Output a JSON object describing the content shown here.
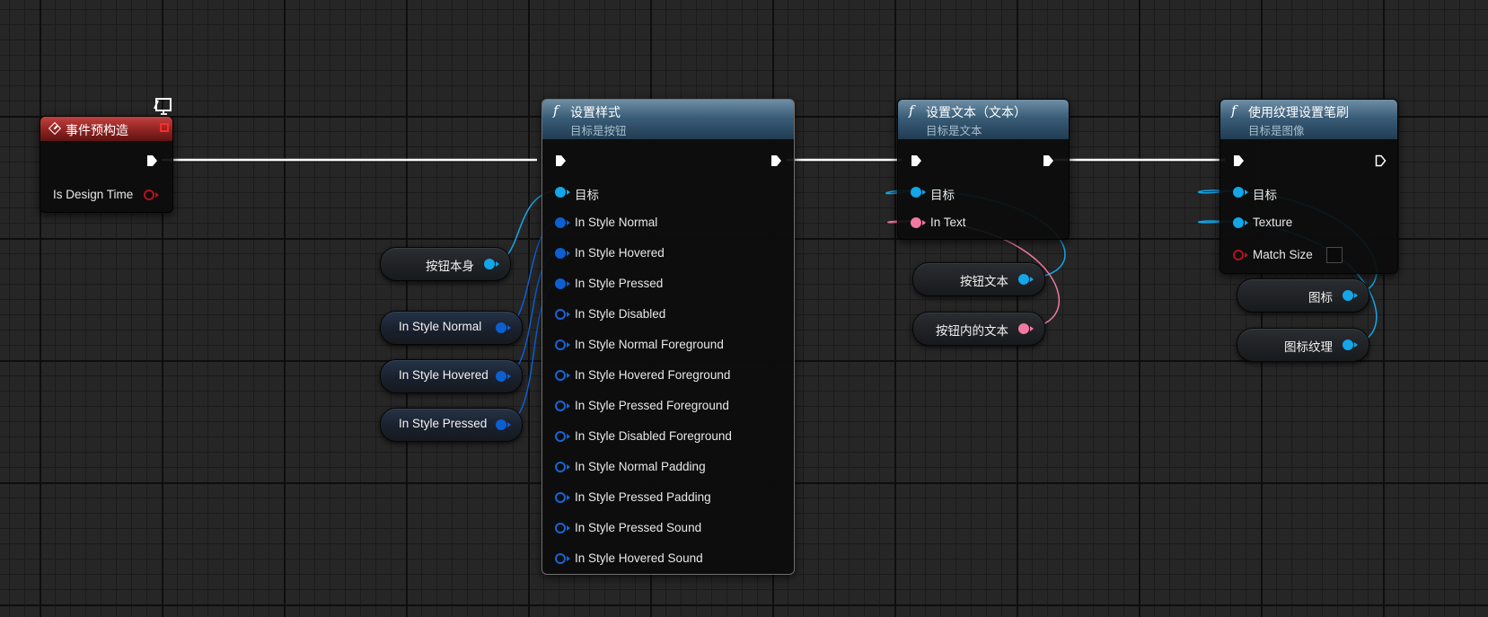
{
  "event_node": {
    "title": "事件预构造",
    "pins": [
      {
        "label": "Is Design Time"
      }
    ]
  },
  "set_style_node": {
    "title": "设置样式",
    "subtitle": "目标是按钮",
    "pins": [
      {
        "label": "目标"
      },
      {
        "label": "In Style Normal"
      },
      {
        "label": "In Style Hovered"
      },
      {
        "label": "In Style Pressed"
      },
      {
        "label": "In Style Disabled"
      },
      {
        "label": "In Style Normal Foreground"
      },
      {
        "label": "In Style Hovered Foreground"
      },
      {
        "label": "In Style Pressed Foreground"
      },
      {
        "label": "In Style Disabled Foreground"
      },
      {
        "label": "In Style Normal Padding"
      },
      {
        "label": "In Style Pressed Padding"
      },
      {
        "label": "In Style Pressed Sound"
      },
      {
        "label": "In Style Hovered Sound"
      }
    ]
  },
  "set_text_node": {
    "title": "设置文本（文本）",
    "subtitle": "目标是文本",
    "pins": [
      {
        "label": "目标"
      },
      {
        "label": "In Text"
      }
    ]
  },
  "set_brush_node": {
    "title": "使用纹理设置笔刷",
    "subtitle": "目标是图像",
    "pins": [
      {
        "label": "目标"
      },
      {
        "label": "Texture"
      },
      {
        "label": "Match Size"
      }
    ]
  },
  "variables": [
    {
      "label": "按钮本身"
    },
    {
      "label": "In Style Normal"
    },
    {
      "label": "In Style Hovered"
    },
    {
      "label": "In Style Pressed"
    },
    {
      "label": "按钮文本"
    },
    {
      "label": "按钮内的文本"
    },
    {
      "label": "图标"
    },
    {
      "label": "图标纹理"
    }
  ],
  "colors": {
    "exec_wire": "#ffffff",
    "object_wire": "#13a6e8",
    "struct_wire": "#0b5fd1",
    "text_wire": "#f07aa2",
    "bool_pin": "#b3121e",
    "function_header": "#3a5d78",
    "event_header": "#8f2322"
  }
}
